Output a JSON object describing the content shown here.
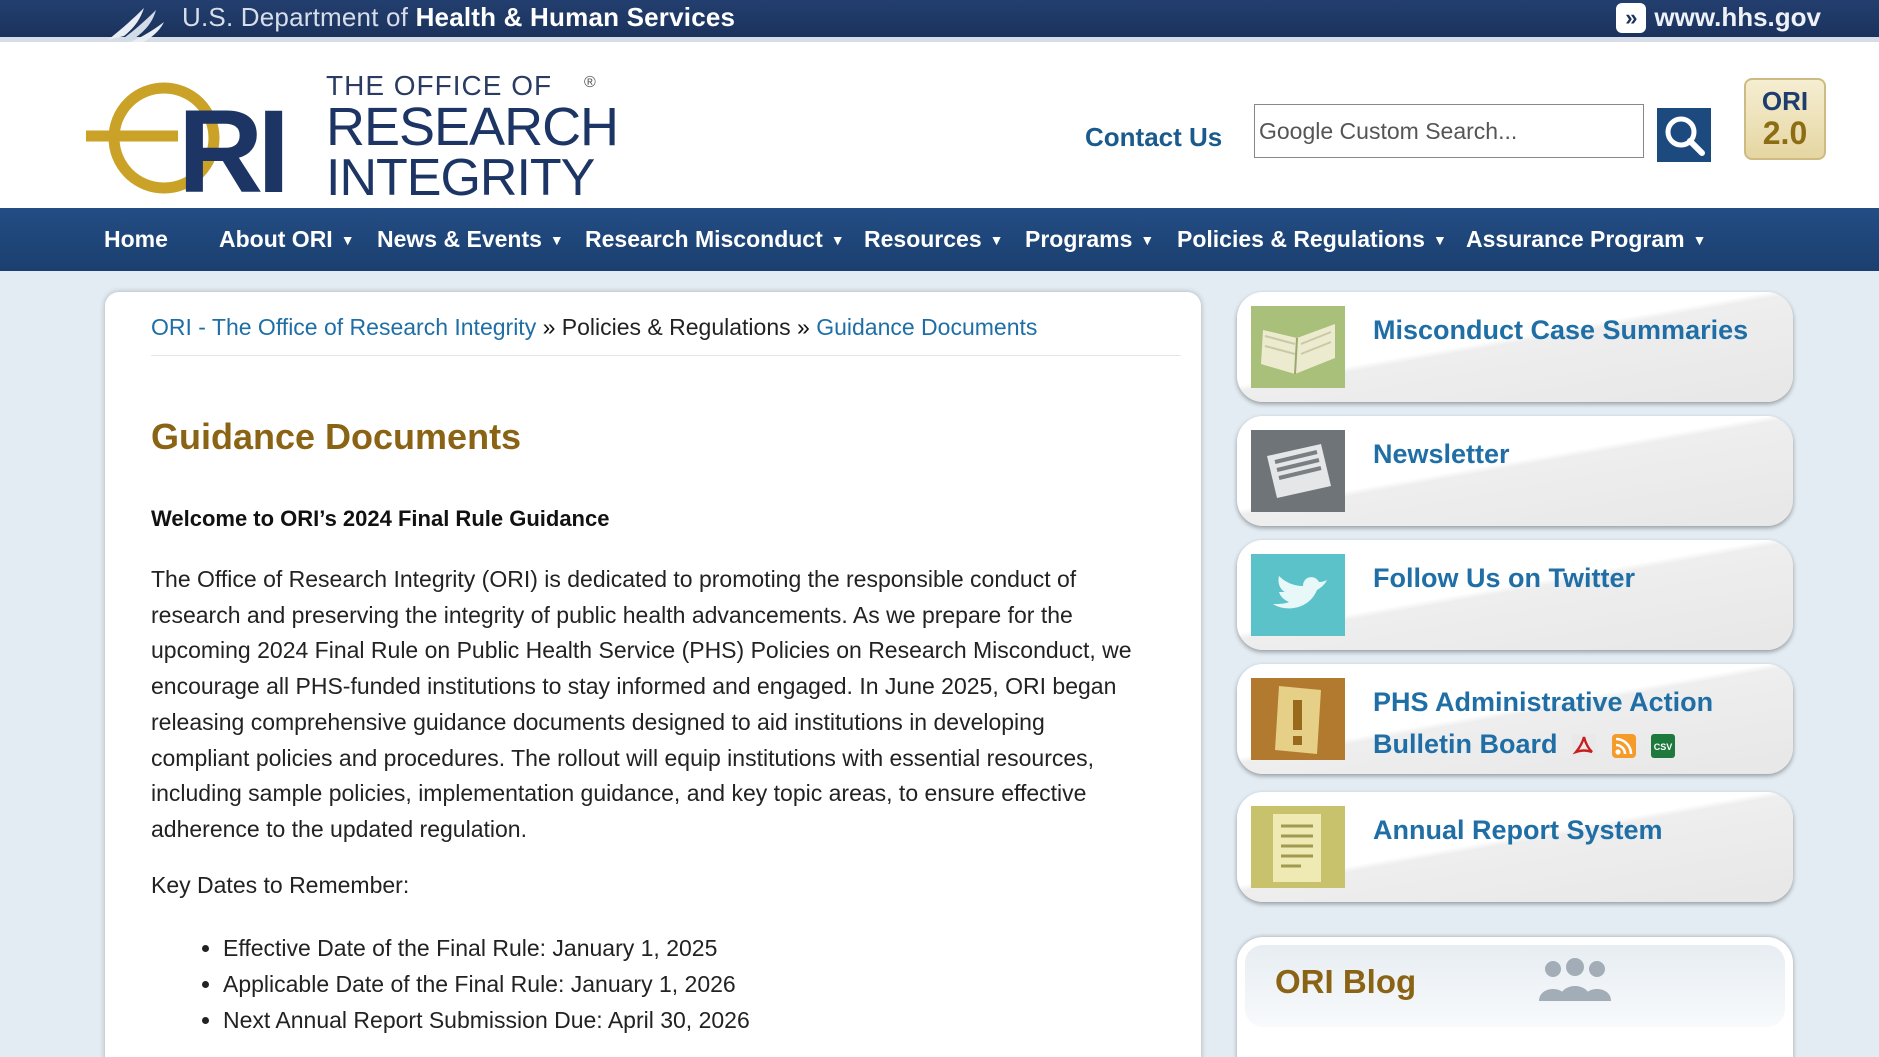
{
  "hhs": {
    "dept_prefix": "U.S. Department of",
    "dept_name": "Health & Human Services",
    "site_link": "www.hhs.gov"
  },
  "header": {
    "logo_line1": "THE OFFICE OF",
    "logo_line2": "RESEARCH",
    "logo_line3": "INTEGRITY",
    "logo_mark": "ORI",
    "contact_label": "Contact Us",
    "search_placeholder": "Google Custom Search...",
    "badge_line1": "ORI",
    "badge_line2": "2.0"
  },
  "nav": {
    "items": [
      {
        "label": "Home",
        "has_menu": false
      },
      {
        "label": "About ORI",
        "has_menu": true
      },
      {
        "label": "News & Events",
        "has_menu": true
      },
      {
        "label": "Research Misconduct",
        "has_menu": true
      },
      {
        "label": "Resources",
        "has_menu": true
      },
      {
        "label": "Programs",
        "has_menu": true
      },
      {
        "label": "Policies & Regulations",
        "has_menu": true
      },
      {
        "label": "Assurance Program",
        "has_menu": true
      }
    ]
  },
  "breadcrumb": {
    "home": "ORI - The Office of Research Integrity",
    "sep": "»",
    "section": "Policies & Regulations",
    "current": "Guidance Documents"
  },
  "main": {
    "title": "Guidance Documents",
    "welcome": "Welcome to ORI’s 2024 Final Rule Guidance",
    "intro_lines": [
      "The Office of Research Integrity (ORI) is dedicated to promoting the responsible conduct of",
      "research and preserving the integrity of public health advancements. As we prepare for the",
      "upcoming 2024 Final Rule on Public Health Service (PHS) Policies on Research Misconduct, we",
      "encourage all PHS-funded institutions to stay informed and engaged. In June 2025, ORI began",
      "releasing comprehensive guidance documents designed to aid institutions in developing",
      "compliant policies and procedures. The rollout will equip institutions with essential resources,",
      "including sample policies, implementation guidance, and key topic areas, to ensure effective",
      "adherence to the updated regulation."
    ],
    "key_dates_label": "Key Dates to Remember:",
    "key_dates": [
      "Effective Date of the Final Rule: January 1, 2025",
      "Applicable Date of the Final Rule: January 1, 2026",
      "Next Annual Report Submission Due: April 30, 2026"
    ]
  },
  "sidebar": {
    "cards": [
      {
        "title": "Misconduct Case Summaries"
      },
      {
        "title": "Newsletter"
      },
      {
        "title": "Follow Us on Twitter"
      },
      {
        "title_line1": "PHS Administrative Action",
        "title_line2": "Bulletin Board",
        "csv_label": "CSV"
      },
      {
        "title": "Annual Report System"
      }
    ],
    "blog_title": "ORI Blog"
  },
  "colors": {
    "nav_bg": "#1f4679",
    "link_blue": "#1f6fa6",
    "title_gold": "#8a6414",
    "hhs_bar": "#1f3a66"
  }
}
